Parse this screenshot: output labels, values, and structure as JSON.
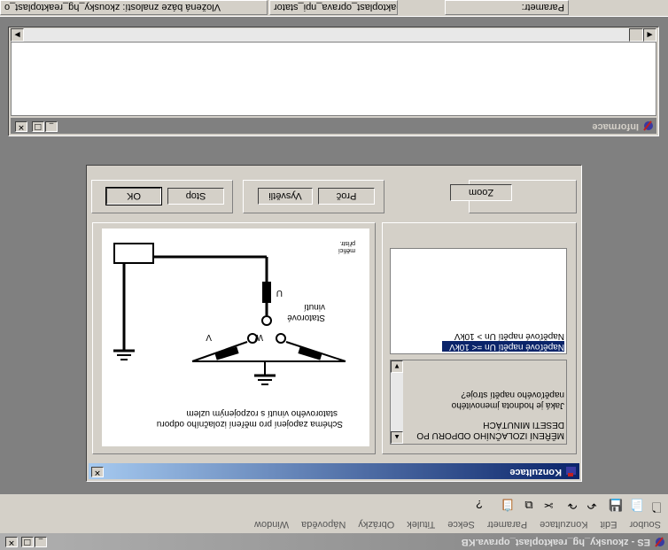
{
  "app": {
    "title": "ES - zkousky_hg_reaktoplast_oprava.KB",
    "menu": [
      "Soubor",
      "Edit",
      "Konzultace",
      "Parametr",
      "Sekce",
      "Titulek",
      "Obrázky",
      "Nápověda",
      "Window"
    ]
  },
  "statusbar": {
    "kb_label": "Vložená báze znalostí:  zkousky_hg_reaktoplast_o",
    "section_label": "Section:  hg_reaktoplast_oprava_npi_stator",
    "parameter_label": "Parametr:"
  },
  "info_window": {
    "title": "Informace"
  },
  "konzultace": {
    "title": "Konzultace",
    "buttons": {
      "ok": "OK",
      "stop": "Stop",
      "vysvetli": "Vysvětli",
      "proc": "Proč",
      "zoom": "Zoom"
    },
    "question_lines": [
      "MĚŘENÍ IZOLAČNÍHO ODPORU PO",
      "DESETI MINUTÁCH",
      "Jaká je hodnota jmenovitého",
      "napěťového napětí stroje?"
    ],
    "options": [
      "Napěťové napětí Un =< 10kV",
      "Napěťové napětí Un > 10kV"
    ],
    "selected_option": 0
  },
  "diagram": {
    "caption_line1": "Schéma zapojení pro měření izolačního odporu",
    "caption_line2": "statorového vinutí s rozpojeným uzlem",
    "label_u": "U",
    "label_v": "V",
    "label_w": "W",
    "label_stator_1": "Statorové",
    "label_stator_2": "vinutí",
    "meter_line1": "měřicí",
    "meter_line2": "přístr."
  },
  "toolbar": {
    "icons": [
      "new-doc-icon",
      "open-doc-icon",
      "save-icon",
      "undo-icon",
      "redo-icon",
      "cut-icon",
      "copy-icon",
      "paste-icon",
      "help-icon"
    ]
  }
}
